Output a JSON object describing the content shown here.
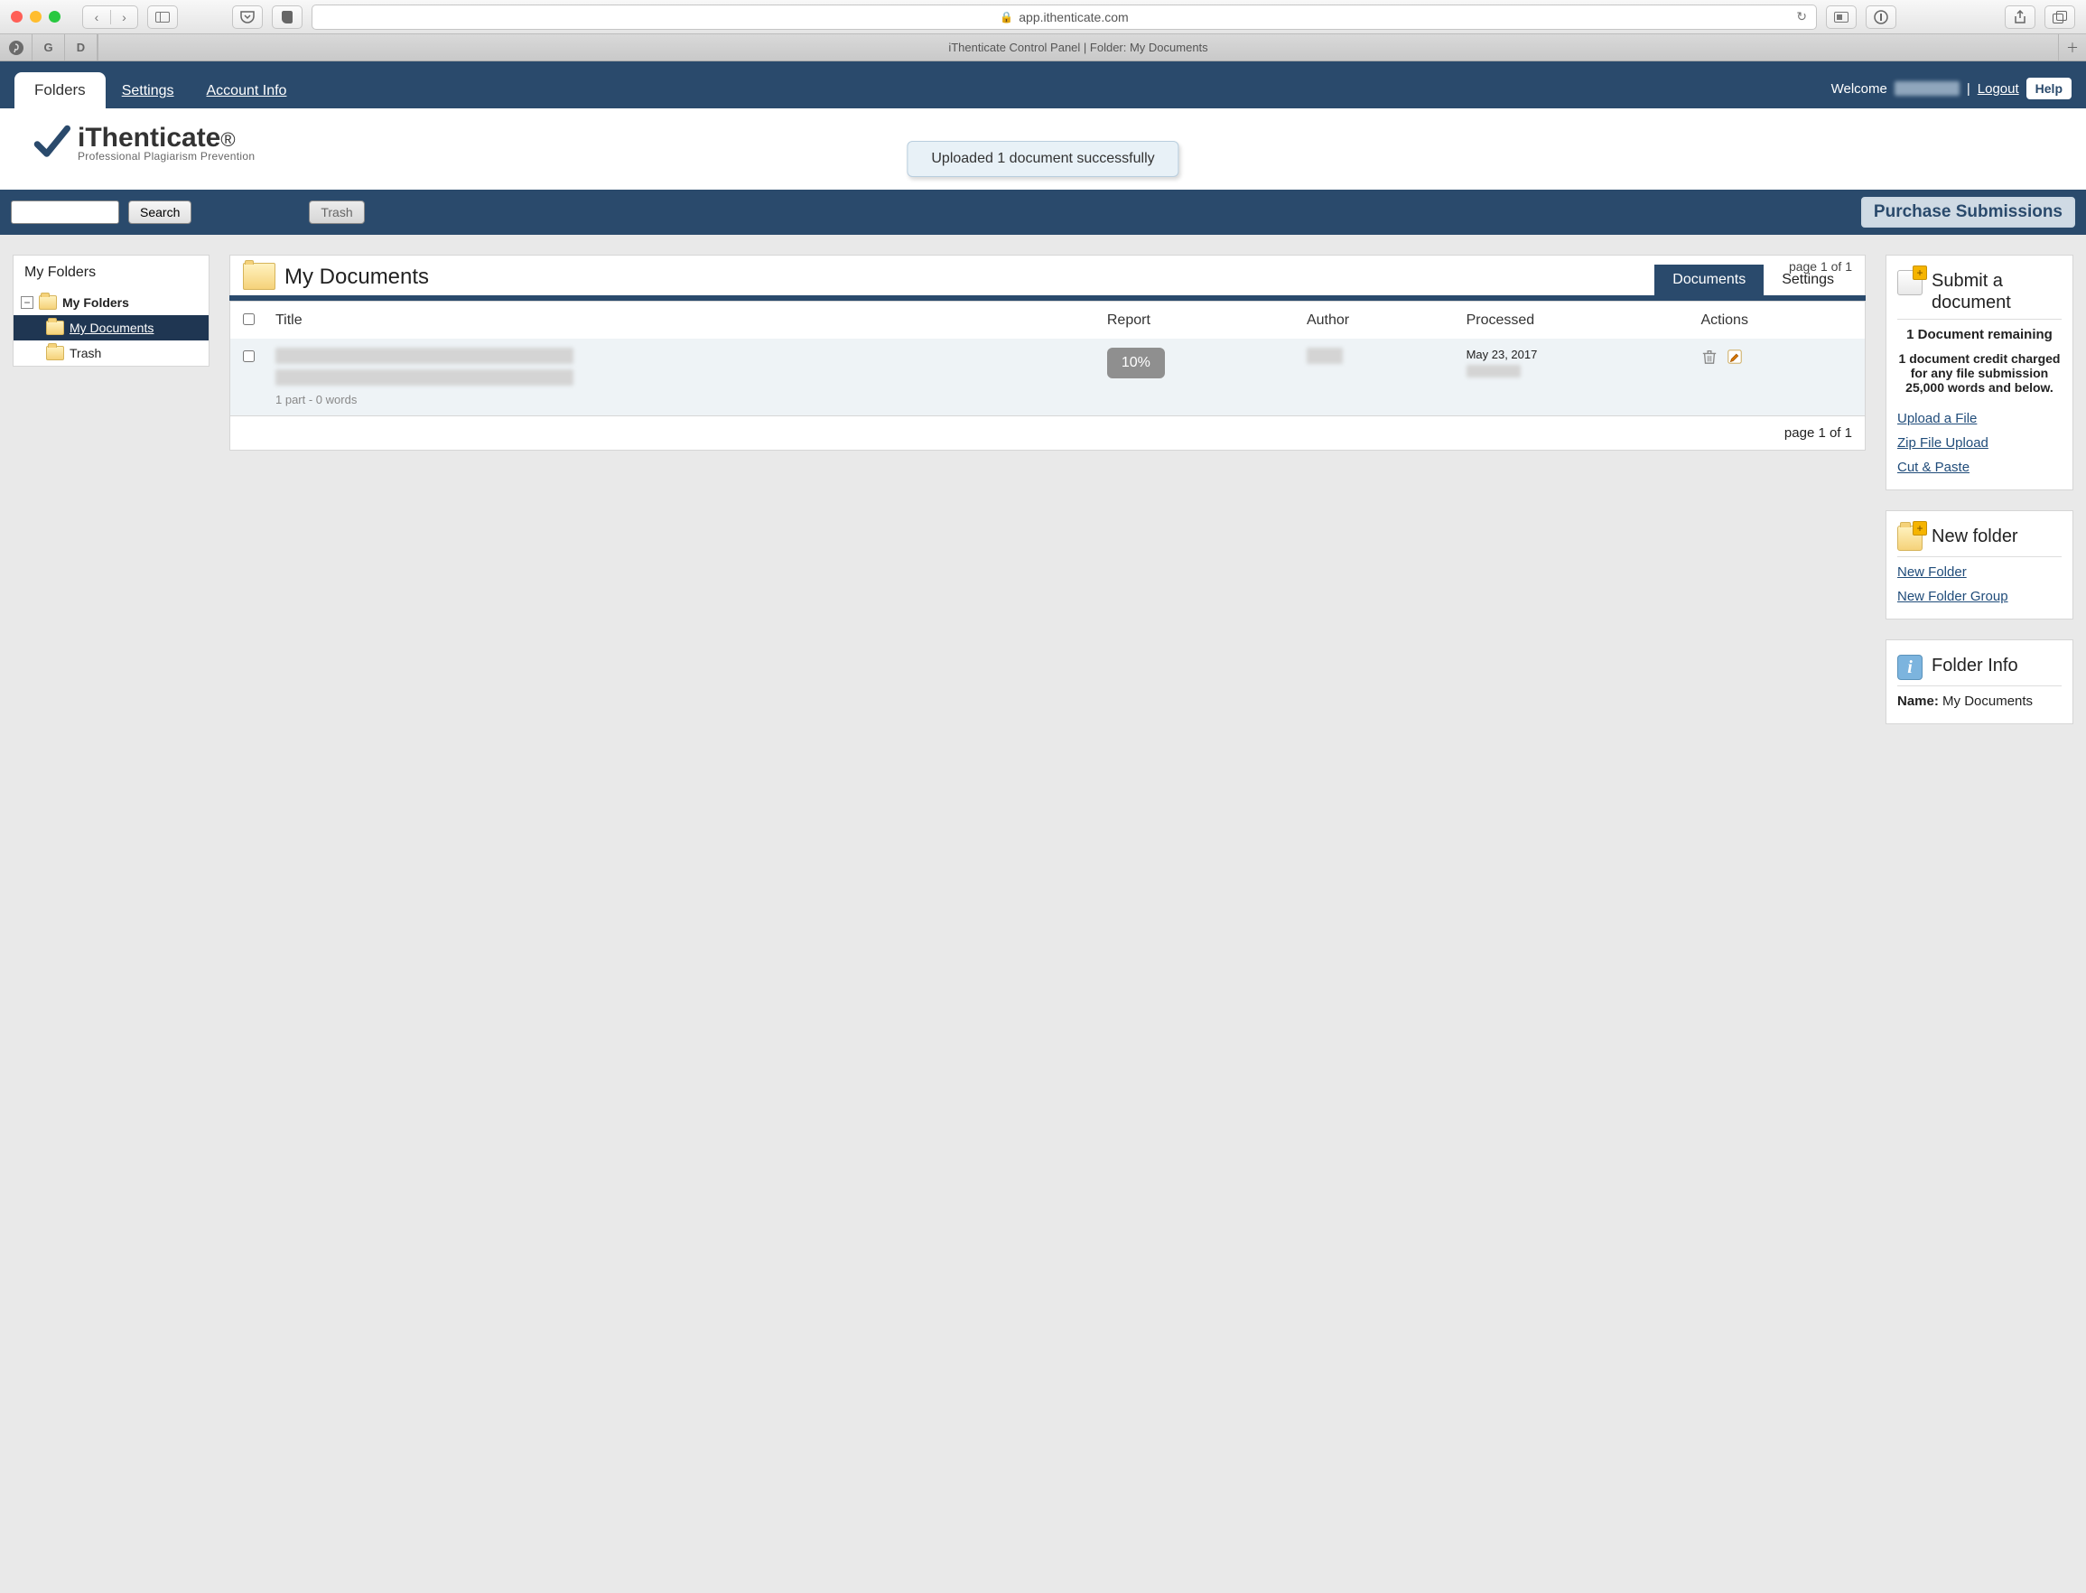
{
  "browser": {
    "url_host": "app.ithenticate.com",
    "tab_title": "iThenticate Control Panel | Folder: My Documents"
  },
  "topnav": {
    "tabs": {
      "folders": "Folders",
      "settings": "Settings",
      "account_info": "Account Info"
    },
    "welcome": "Welcome",
    "logout": "Logout",
    "help": "Help"
  },
  "brand": {
    "name": "iThenticate",
    "tagline": "Professional Plagiarism Prevention"
  },
  "toast": "Uploaded 1 document successfully",
  "toolbar": {
    "search_label": "Search",
    "trash_label": "Trash",
    "purchase_label": "Purchase Submissions"
  },
  "folders_panel": {
    "heading": "My Folders",
    "tree": {
      "root": "My Folders",
      "children": [
        {
          "name": "My Documents",
          "selected": true
        },
        {
          "name": "Trash",
          "selected": false
        }
      ]
    }
  },
  "docs": {
    "title": "My Documents",
    "page_indicator": "page 1 of 1",
    "tabs": {
      "documents": "Documents",
      "settings": "Settings"
    },
    "columns": {
      "title": "Title",
      "report": "Report",
      "author": "Author",
      "processed": "Processed",
      "actions": "Actions"
    },
    "rows": [
      {
        "title": "",
        "report_percent": "10%",
        "author": "",
        "processed_date": "May 23, 2017",
        "meta": "1 part - 0 words"
      }
    ]
  },
  "submit_card": {
    "heading": "Submit a document",
    "remaining": "1 Document remaining",
    "detail": "1 document credit charged for any file submission 25,000 words and below.",
    "links": {
      "upload": "Upload a File",
      "zip": "Zip File Upload",
      "paste": "Cut & Paste"
    }
  },
  "newfolder_card": {
    "heading": "New folder",
    "links": {
      "folder": "New Folder",
      "group": "New Folder Group"
    }
  },
  "folderinfo_card": {
    "heading": "Folder Info",
    "name_label": "Name:",
    "name_value": "My Documents"
  }
}
